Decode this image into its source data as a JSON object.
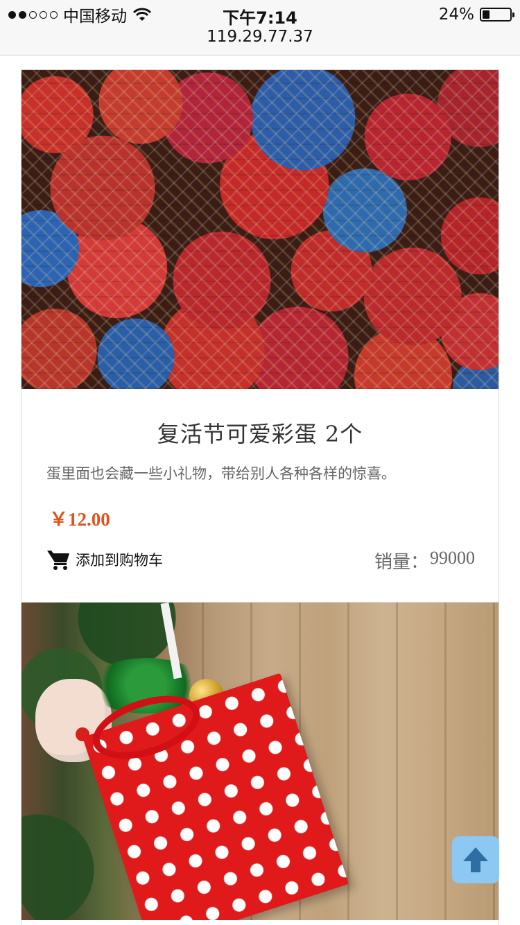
{
  "status_bar": {
    "carrier": "中国移动",
    "time": "下午7:14",
    "battery": "24%",
    "battery_level": 0.24,
    "signal_bars_filled": 2,
    "signal_bars_total": 5,
    "url": "119.29.77.37"
  },
  "products": [
    {
      "title": "复活节可爱彩蛋 2个",
      "description": "蛋里面也会藏一些小礼物，带给别人各种各样的惊喜。",
      "price": "￥12.00",
      "add_to_cart_label": "添加到购物车",
      "sales_label": "销量：",
      "sales_value": "99000",
      "image_icon": "easter-eggs-image"
    },
    {
      "image_icon": "christmas-gift-image"
    }
  ],
  "back_to_top": {
    "icon": "arrow-up-icon"
  },
  "colors": {
    "price": "#e2521c",
    "back_to_top_bg": "#8cc8f2",
    "back_to_top_arrow": "#2e6ea3"
  }
}
